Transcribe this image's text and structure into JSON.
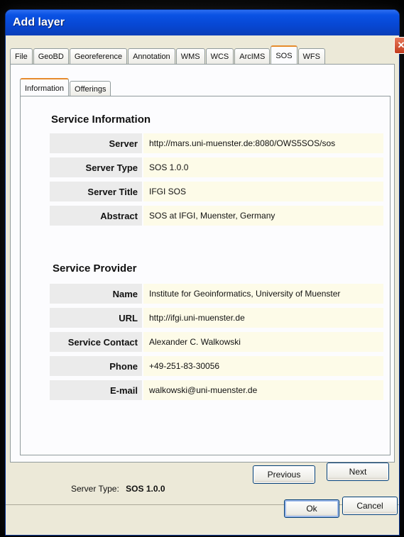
{
  "window": {
    "title": "Add layer",
    "close_glyph": "✕"
  },
  "outer_tabs": [
    "File",
    "GeoBD",
    "Georeference",
    "Annotation",
    "WMS",
    "WCS",
    "ArcIMS",
    "SOS",
    "WFS"
  ],
  "outer_active": "SOS",
  "inner_tabs": [
    "Information",
    "Offerings"
  ],
  "service_information": {
    "title": "Service Information",
    "rows": [
      {
        "label": "Server",
        "value": "http://mars.uni-muenster.de:8080/OWS5SOS/sos"
      },
      {
        "label": "Server Type",
        "value": "SOS 1.0.0"
      },
      {
        "label": "Server Title",
        "value": "IFGI SOS"
      },
      {
        "label": "Abstract",
        "value": "SOS at IFGI, Muenster, Germany"
      }
    ]
  },
  "service_provider": {
    "title": "Service Provider",
    "rows": [
      {
        "label": "Name",
        "value": "Institute for Geoinformatics, University of Muenster"
      },
      {
        "label": "URL",
        "value": "http://ifgi.uni-muenster.de"
      },
      {
        "label": "Service Contact",
        "value": "Alexander C. Walkowski"
      },
      {
        "label": "Phone",
        "value": "+49-251-83-30056"
      },
      {
        "label": "E-mail",
        "value": "walkowski@uni-muenster.de"
      }
    ]
  },
  "footer": {
    "server_type_label": "Server Type:",
    "server_type_value": "SOS 1.0.0"
  },
  "buttons": {
    "previous": "Previous",
    "next": "Next",
    "ok": "Ok",
    "cancel": "Cancel"
  },
  "colors": {
    "title_bar": "#0a52e4",
    "active_tab_accent": "#e68b2c",
    "label_bg": "#ebebeb",
    "value_bg": "#fdfbe8"
  }
}
